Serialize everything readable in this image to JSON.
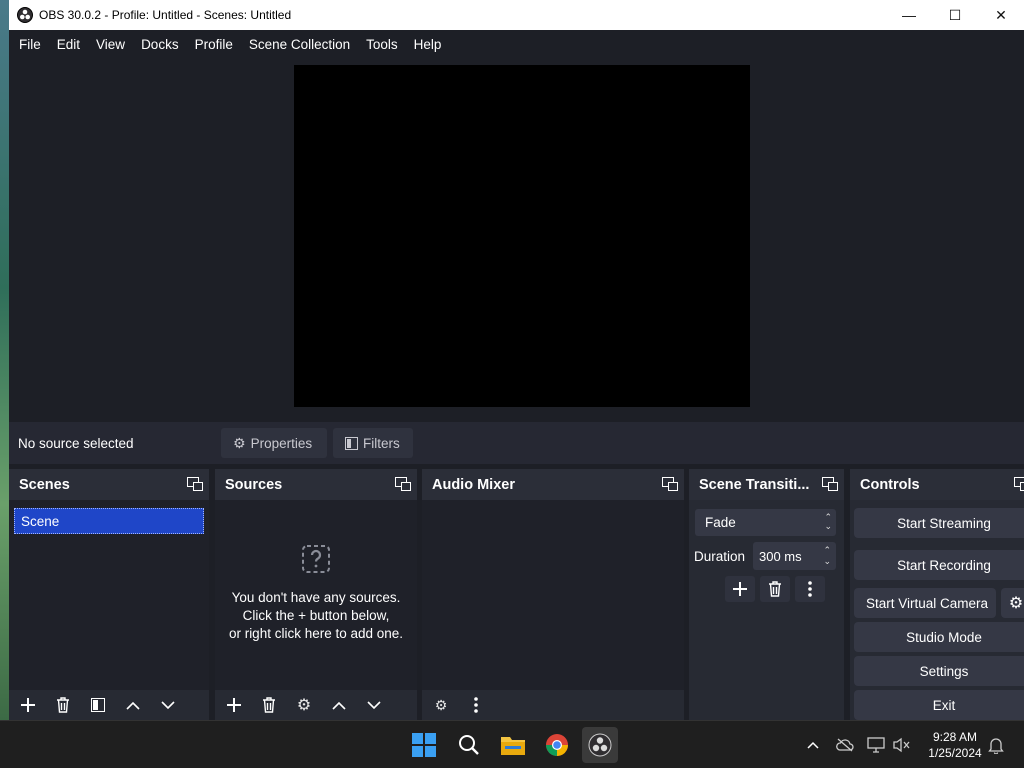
{
  "window": {
    "title": "OBS 30.0.2 - Profile: Untitled - Scenes: Untitled",
    "minimize": "—",
    "maximize": "☐",
    "close": "✕"
  },
  "menu": [
    "File",
    "Edit",
    "View",
    "Docks",
    "Profile",
    "Scene Collection",
    "Tools",
    "Help"
  ],
  "source_toolbar": {
    "status": "No source selected",
    "properties": "Properties",
    "filters": "Filters"
  },
  "docks": {
    "scenes": {
      "title": "Scenes",
      "items": [
        "Scene"
      ]
    },
    "sources": {
      "title": "Sources",
      "empty_line1": "You don't have any sources.",
      "empty_line2": "Click the + button below,",
      "empty_line3": "or right click here to add one."
    },
    "mixer": {
      "title": "Audio Mixer"
    },
    "transitions": {
      "title": "Scene Transiti...",
      "selected": "Fade",
      "duration_label": "Duration",
      "duration_value": "300 ms"
    },
    "controls": {
      "title": "Controls",
      "start_streaming": "Start Streaming",
      "start_recording": "Start Recording",
      "start_virtual_camera": "Start Virtual Camera",
      "studio_mode": "Studio Mode",
      "settings": "Settings",
      "exit": "Exit"
    }
  },
  "taskbar": {
    "time": "9:28 AM",
    "date": "1/25/2024"
  },
  "colors": {
    "window_bg": "#1d1f26",
    "dock_bg": "#272a33",
    "button_bg": "#353845",
    "selection": "#1f46c8",
    "taskbar": "#1f1f1f"
  }
}
